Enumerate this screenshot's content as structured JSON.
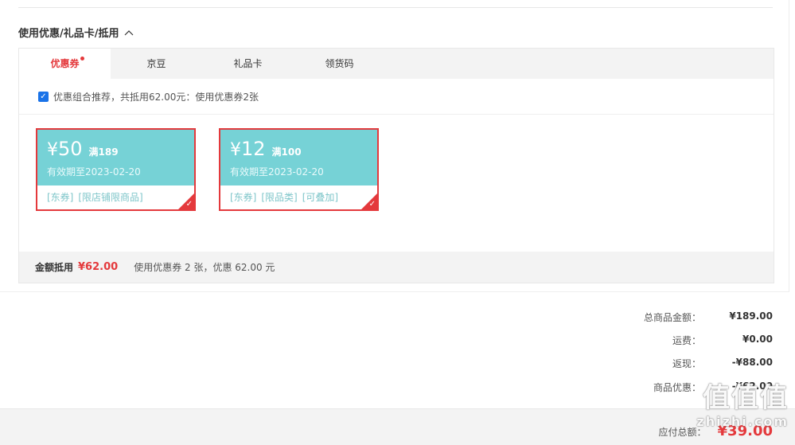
{
  "section": {
    "title": "使用优惠/礼品卡/抵用",
    "chevron_icon": "chevron-up-icon"
  },
  "tabs": [
    {
      "label": "优惠券",
      "active": true,
      "dot": true
    },
    {
      "label": "京豆"
    },
    {
      "label": "礼品卡"
    },
    {
      "label": "领货码"
    }
  ],
  "recommend": {
    "checked": true,
    "text": "优惠组合推荐，共抵用62.00元：使用优惠券2张"
  },
  "coupons": [
    {
      "symbol": "¥",
      "value": "50",
      "condition": "满189",
      "validity": "有效期至2023-02-20",
      "tags": [
        "[东券]",
        "[限店铺限商品]"
      ],
      "selected": true
    },
    {
      "symbol": "¥",
      "value": "12",
      "condition": "满100",
      "validity": "有效期至2023-02-20",
      "tags": [
        "[东券]",
        "[限品类]",
        "[可叠加]"
      ],
      "selected": true
    }
  ],
  "summary": {
    "label": "金额抵用",
    "amount": "¥62.00",
    "desc": "使用优惠券 2 张，优惠 62.00 元"
  },
  "totals": [
    {
      "label": "总商品金额：",
      "value": "¥189.00"
    },
    {
      "label": "运费：",
      "value": "¥0.00"
    },
    {
      "label": "返现：",
      "value": "-¥88.00"
    },
    {
      "label": "商品优惠：",
      "value": "-¥62.00"
    }
  ],
  "payable": {
    "label": "应付总额：",
    "value": "¥39.00"
  },
  "watermark": {
    "logo": "值值值",
    "site": "zhizhi.com"
  },
  "colors": {
    "accent": "#e4393c",
    "coupon_bg": "#76d2d6",
    "bar_bg": "#f3f3f3"
  }
}
